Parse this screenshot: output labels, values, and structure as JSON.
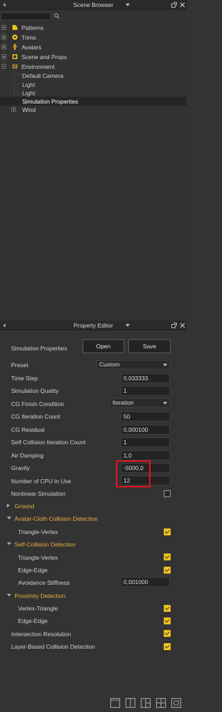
{
  "scene_browser": {
    "title": "Scene Browser",
    "tree": [
      {
        "label": "Patterns",
        "icon": "patterns-icon",
        "expander": "plus"
      },
      {
        "label": "Trims",
        "icon": "trims-icon",
        "expander": "plus"
      },
      {
        "label": "Avatars",
        "icon": "avatar-icon",
        "expander": "plus"
      },
      {
        "label": "Scene and Props",
        "icon": "scene-props-icon",
        "expander": "plus"
      },
      {
        "label": "Environment",
        "icon": "globe-icon",
        "expander": "minus"
      },
      {
        "label": "Default Camera"
      },
      {
        "label": "Light"
      },
      {
        "label": "Light"
      },
      {
        "label": "Simulation Properties",
        "selected": true
      },
      {
        "label": "Wind",
        "expander": "plus"
      }
    ]
  },
  "property_editor": {
    "title": "Property Editor",
    "header_label": "Simulation Properties",
    "open_label": "Open",
    "save_label": "Save",
    "preset": {
      "label": "Preset",
      "value": "Custom"
    },
    "rows": {
      "time_step": {
        "label": "Time Step",
        "value": "0,033333"
      },
      "sim_quality": {
        "label": "Simulation Quality",
        "value": "1"
      },
      "cg_finish": {
        "label": "CG Finish Condition",
        "value": "Iteration"
      },
      "cg_iter": {
        "label": "CG Iteration Count",
        "value": "50"
      },
      "cg_residual": {
        "label": "CG Residual",
        "value": "0,000100"
      },
      "self_coll_iter": {
        "label": "Self Collision Iteration Count",
        "value": "1"
      },
      "air_damping": {
        "label": "Air Damping",
        "value": "1,0"
      },
      "gravity": {
        "label": "Gravity",
        "value": "-5000,0"
      },
      "num_cpu": {
        "label": "Number of CPU in Use",
        "value": "12"
      },
      "nonlinear": {
        "label": "Nonlinear Simulation",
        "checked": false
      }
    },
    "groups": {
      "ground": "Ground",
      "avatar_cloth": "Avatar-Cloth Collision Detection",
      "self_collision": "Self-Collision Detection",
      "proximity": "Proximity Detection"
    },
    "sub_rows": {
      "ac_triangle_vertex": {
        "label": "Triangle-Vertex",
        "checked": true
      },
      "sc_triangle_vertex": {
        "label": "Triangle-Vertex",
        "checked": true
      },
      "sc_edge_edge": {
        "label": "Edge-Edge",
        "checked": true
      },
      "avoidance_stiffness": {
        "label": "Avoidance Stiffness",
        "value": "0,001000"
      },
      "pd_vertex_triangle": {
        "label": "Vertex-Triangle",
        "checked": true
      },
      "pd_edge_edge": {
        "label": "Edge-Edge",
        "checked": true
      },
      "intersection_resolution": {
        "label": "Intersection Resolution",
        "checked": true
      },
      "layer_based": {
        "label": "Layer-Based Collision Detection",
        "checked": true
      }
    }
  },
  "colors": {
    "accent_yellow": "#f0c21c",
    "group_header": "#e8b23d",
    "highlight_red": "#e8121f"
  }
}
